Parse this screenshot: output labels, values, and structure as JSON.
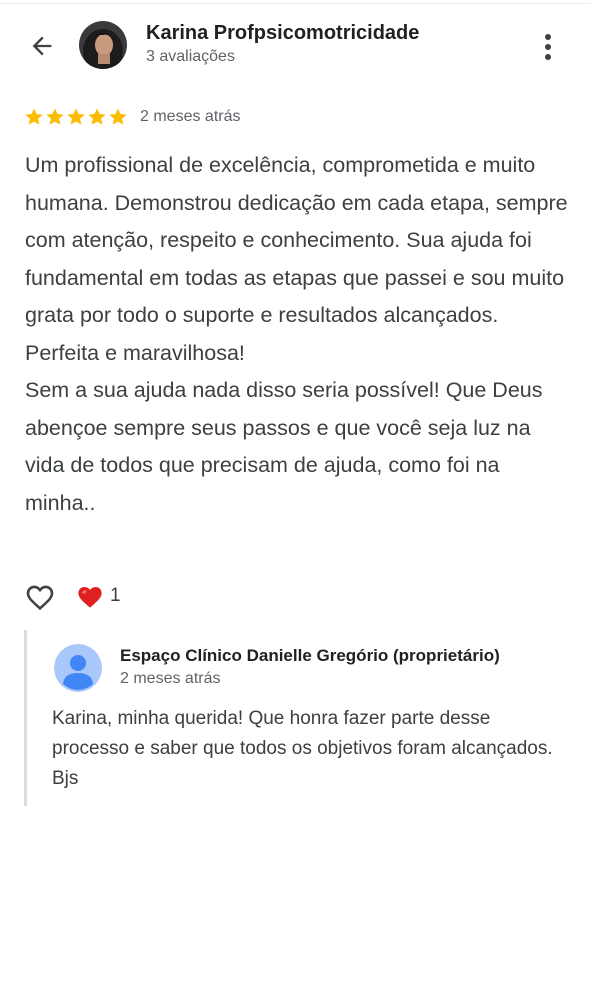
{
  "header": {
    "author_name": "Karina Profpsicomotricidade",
    "author_meta": "3 avaliações",
    "icons": {
      "back": "arrow-back-icon",
      "more": "more-vert-icon"
    }
  },
  "review": {
    "stars": 5,
    "max_stars": 5,
    "star_color": "#fbbc04",
    "date": "2 meses atrás",
    "text": "Um profissional de excelência, comprometida e muito humana. Demonstrou dedicação em cada etapa, sempre com atenção, respeito e conhecimento. Sua ajuda foi fundamental em todas as etapas que passei e sou muito grata por todo o suporte e resultados alcançados.\nPerfeita e maravilhosa!\nSem a sua ajuda nada disso seria possível! Que Deus abençoe sempre seus passos e que você seja luz na vida de todos que precisam de ajuda, como foi na minha.."
  },
  "reactions": {
    "like_icon": "heart-outline-icon",
    "reaction_icon": "red-heart-icon",
    "reaction_color": "#e0201f",
    "count": "1"
  },
  "reply": {
    "owner_name": "Espaço Clínico Danielle Gregório (proprietário)",
    "date": "2 meses atrás",
    "text": "Karina, minha querida! Que honra fazer parte desse processo e saber que todos os objetivos foram alcançados. Bjs",
    "avatar_color": "#a8c7fa"
  }
}
